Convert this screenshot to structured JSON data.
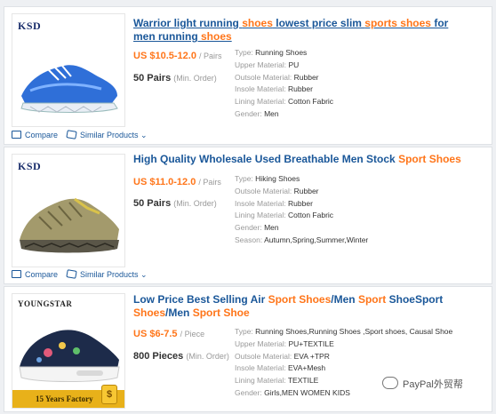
{
  "products": [
    {
      "logo": "KSD",
      "title_parts": [
        {
          "t": "Warrior light running ",
          "hl": false
        },
        {
          "t": "shoes",
          "hl": true
        },
        {
          "t": " lowest price slim ",
          "hl": false
        },
        {
          "t": "sports shoes",
          "hl": true
        },
        {
          "t": " for men running ",
          "hl": false
        },
        {
          "t": "shoes",
          "hl": true
        }
      ],
      "price": "US $10.5-12.0",
      "price_unit": "/ Pairs",
      "moq": "50 Pairs",
      "moq_note": "(Min. Order)",
      "attributes": [
        {
          "key": "Type:",
          "value": "Running Shoes"
        },
        {
          "key": "Upper Material:",
          "value": "PU"
        },
        {
          "key": "Outsole Material:",
          "value": "Rubber"
        },
        {
          "key": "Insole Material:",
          "value": "Rubber"
        },
        {
          "key": "Lining Material:",
          "value": "Cotton Fabric"
        },
        {
          "key": "Gender:",
          "value": "Men"
        }
      ],
      "compare_label": "Compare",
      "similar_label": "Similar Products"
    },
    {
      "logo": "KSD",
      "title_parts": [
        {
          "t": "High Quality Wholesale Used Breathable Men Stock ",
          "hl": false
        },
        {
          "t": "Sport Shoes",
          "hl": true
        }
      ],
      "price": "US $11.0-12.0",
      "price_unit": "/ Pairs",
      "moq": "50 Pairs",
      "moq_note": "(Min. Order)",
      "attributes": [
        {
          "key": "Type:",
          "value": "Hiking Shoes"
        },
        {
          "key": "Outsole Material:",
          "value": "Rubber"
        },
        {
          "key": "Insole Material:",
          "value": "Rubber"
        },
        {
          "key": "Lining Material:",
          "value": "Cotton Fabric"
        },
        {
          "key": "Gender:",
          "value": "Men"
        },
        {
          "key": "Season:",
          "value": "Autumn,Spring,Summer,Winter"
        }
      ],
      "compare_label": "Compare",
      "similar_label": "Similar Products"
    },
    {
      "logo": "YOUNGSTAR",
      "factory_badge": "15 Years Factory",
      "title_parts": [
        {
          "t": "Low Price Best Selling Air ",
          "hl": false
        },
        {
          "t": "Sport Shoes",
          "hl": true
        },
        {
          "t": "/Men ",
          "hl": false
        },
        {
          "t": "Sport",
          "hl": true
        },
        {
          "t": " ShoeSport ",
          "hl": false
        },
        {
          "t": "Shoes",
          "hl": true
        },
        {
          "t": "/Men ",
          "hl": false
        },
        {
          "t": "Sport Shoe",
          "hl": true
        }
      ],
      "price": "US $6-7.5",
      "price_unit": "/ Piece",
      "moq": "800 Pieces",
      "moq_note": "(Min. Order)",
      "attributes": [
        {
          "key": "Type:",
          "value": "Running Shoes,Running Shoes ,Sport shoes, Causal Shoe"
        },
        {
          "key": "Upper Material:",
          "value": "PU+TEXTILE"
        },
        {
          "key": "Outsole Material:",
          "value": "EVA +TPR"
        },
        {
          "key": "Insole Material:",
          "value": "EVA+Mesh"
        },
        {
          "key": "Lining Material:",
          "value": "TEXTILE"
        },
        {
          "key": "Gender:",
          "value": "Girls,MEN WOMEN KIDS"
        }
      ]
    }
  ],
  "watermark": "PayPal外贸帮",
  "colors": {
    "link": "#1a5799",
    "highlight": "#ff7519"
  }
}
